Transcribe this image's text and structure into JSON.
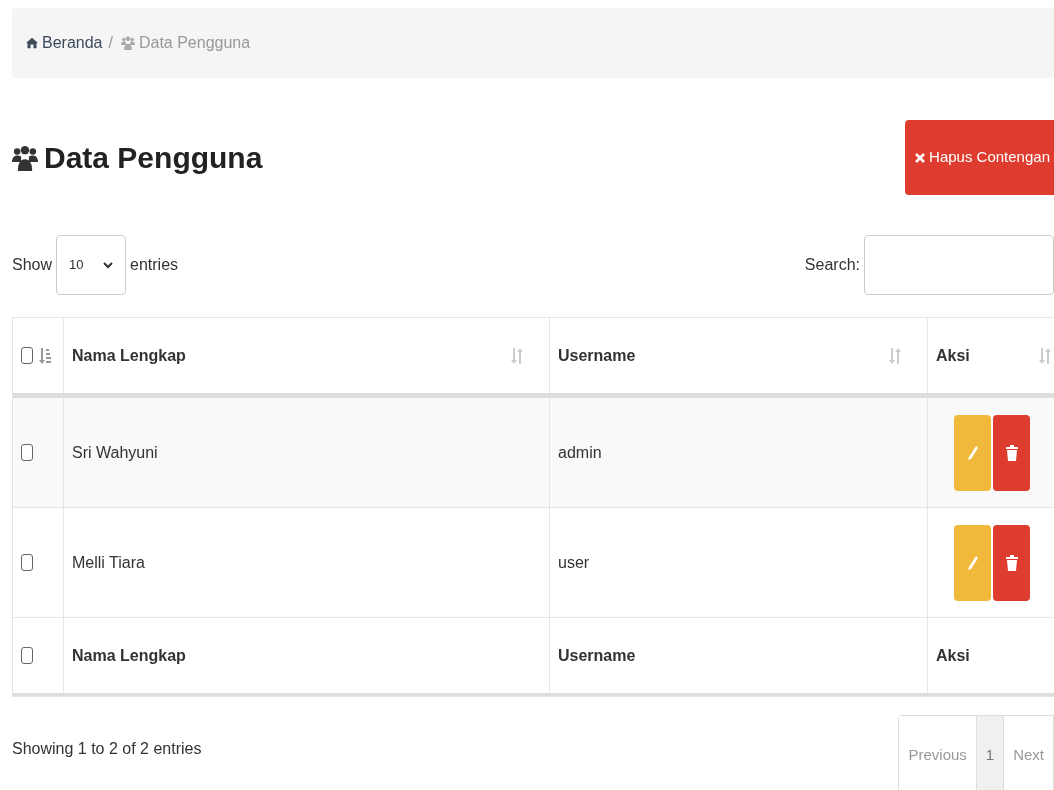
{
  "breadcrumb": [
    {
      "label": "Beranda",
      "kind": "home",
      "selected": false
    },
    {
      "separator": "/",
      "label": "Data Pengguna",
      "kind": "users",
      "selected": true
    }
  ],
  "title": "Data Pengguna",
  "delete_checked_button": "Hapus Contengan",
  "length": {
    "before": "Show",
    "value": "10",
    "after": "entries"
  },
  "search": {
    "label": "Search:"
  },
  "table": {
    "columns": [
      {
        "sorted": true,
        "kind": "check",
        "checked": false
      },
      {
        "label": "Nama Lengkap",
        "sorted": false
      },
      {
        "label": "Username",
        "sorted": false
      },
      {
        "label": "Aksi",
        "sorted": false
      }
    ],
    "rows": [
      {
        "checked": false,
        "name": "Sri Wahyuni",
        "username": "admin"
      },
      {
        "checked": false,
        "name": "Melli Tiara",
        "username": "user"
      }
    ],
    "footer": {
      "checked": false,
      "columns": [
        "Nama Lengkap",
        "Username",
        "Aksi"
      ]
    }
  },
  "info": "Showing 1 to 2 of 2 entries",
  "pagination": [
    {
      "label": "Previous",
      "disabled": true,
      "selected": false
    },
    {
      "label": "1",
      "disabled": false,
      "selected": true
    },
    {
      "label": "Next",
      "disabled": true,
      "selected": false
    }
  ]
}
